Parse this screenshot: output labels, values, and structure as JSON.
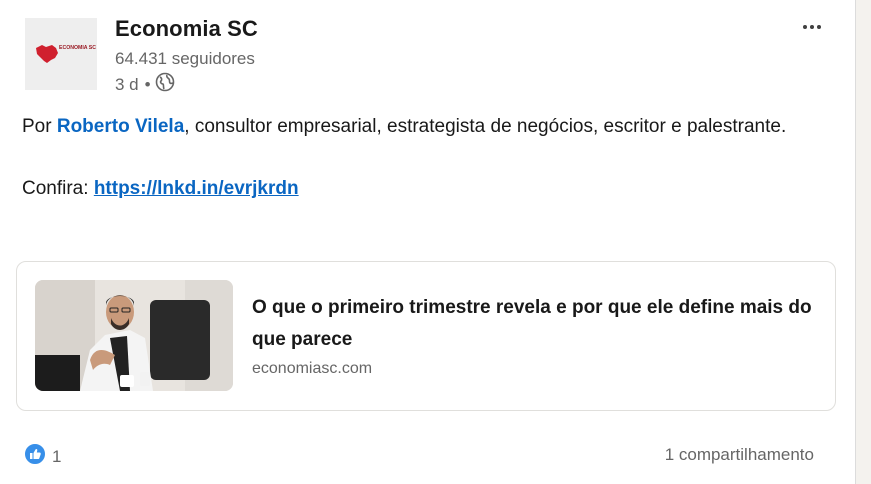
{
  "post": {
    "company_name": "Economia SC",
    "logo_text": "ECONOMIA SC",
    "followers": "64.431 seguidores",
    "time": "3 d",
    "separator": "•",
    "intro_prefix": "Por ",
    "author": "Roberto Vilela",
    "intro_suffix": ", consultor empresarial, estrategista de negócios, escritor e palestrante.",
    "confira_label": "Confira: ",
    "link": "https://lnkd.in/evrjkrdn"
  },
  "preview": {
    "title": "O que o primeiro trimestre revela e por que ele define mais do que parece",
    "source": "economiasc.com"
  },
  "social": {
    "reaction_count": "1",
    "shares": "1 compartilhamento"
  },
  "icons": {
    "more": "more-options-icon",
    "globe": "globe-icon",
    "like": "like-reaction-icon"
  },
  "colors": {
    "link_blue": "#0a66c2",
    "logo_red": "#d0202e",
    "muted_text": "#666666"
  }
}
